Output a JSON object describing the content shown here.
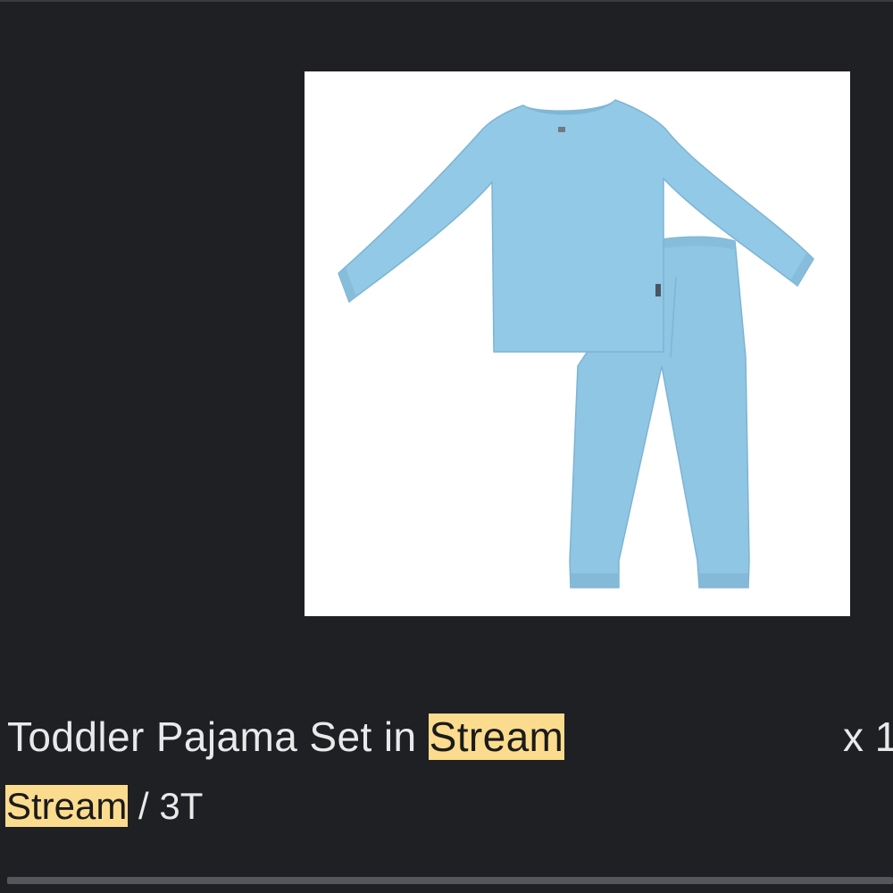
{
  "item": {
    "title_prefix": "Toddler Pajama Set in ",
    "title_highlight": "Stream",
    "quantity_text": "x 1",
    "variant_highlight": "Stream",
    "variant_suffix": " / 3T",
    "highlight_color": "#fbdc8e",
    "product_color": "#8ec7e6"
  }
}
